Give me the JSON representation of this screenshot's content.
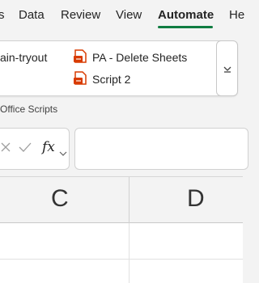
{
  "menu": {
    "tabs": [
      {
        "label": "s"
      },
      {
        "label": "Data"
      },
      {
        "label": "Review"
      },
      {
        "label": "View"
      },
      {
        "label": "Automate"
      },
      {
        "label": "He"
      }
    ],
    "active_tab": "Automate"
  },
  "ribbon": {
    "scripts": [
      {
        "label": "ain-tryout",
        "icon": "script-file-icon"
      },
      {
        "label": "PA - Delete Sheets",
        "icon": "script-file-icon"
      },
      {
        "label": "Script 2",
        "icon": "script-file-icon"
      }
    ],
    "group_label": "Office Scripts",
    "expand_icon": "chevron-down-icon"
  },
  "formula_bar": {
    "cancel_icon": "x-icon",
    "enter_icon": "check-icon",
    "fx_label": "fx",
    "fx_chevron_icon": "chevron-down-icon",
    "value": ""
  },
  "columns": [
    {
      "label": "C"
    },
    {
      "label": "D"
    }
  ],
  "colors": {
    "accent": "#107c41",
    "script_icon": "#d83b01"
  }
}
